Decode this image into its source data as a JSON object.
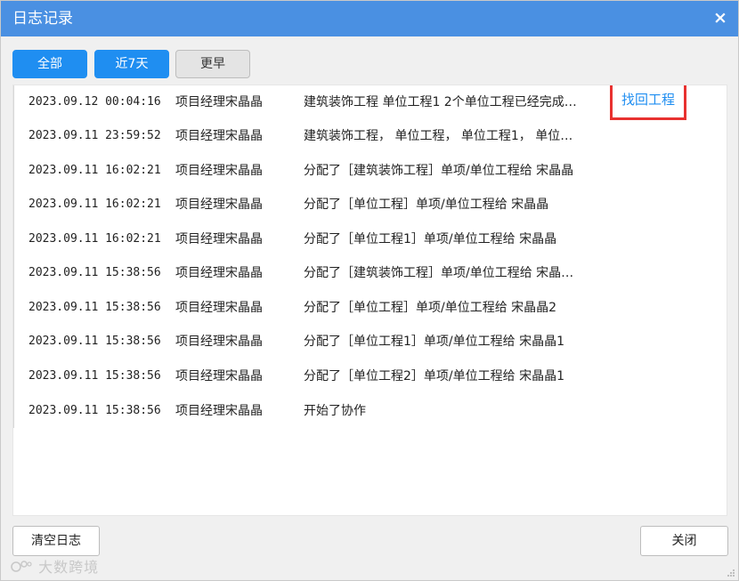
{
  "window": {
    "title": "日志记录",
    "close_glyph": "×"
  },
  "tabs": [
    {
      "label": "全部",
      "active": true
    },
    {
      "label": "近7天",
      "active": true
    },
    {
      "label": "更早",
      "active": false
    }
  ],
  "logs": [
    {
      "time": "2023.09.12 00:04:16",
      "user": "项目经理宋晶晶",
      "action": "建筑装饰工程 单位工程1 2个单位工程已经完成…",
      "link": "找回工程"
    },
    {
      "time": "2023.09.11 23:59:52",
      "user": "项目经理宋晶晶",
      "action": "建筑装饰工程， 单位工程， 单位工程1， 单位…"
    },
    {
      "time": "2023.09.11 16:02:21",
      "user": "项目经理宋晶晶",
      "action": "分配了［建筑装饰工程］单项/单位工程给 宋晶晶"
    },
    {
      "time": "2023.09.11 16:02:21",
      "user": "项目经理宋晶晶",
      "action": "分配了［单位工程］单项/单位工程给 宋晶晶"
    },
    {
      "time": "2023.09.11 16:02:21",
      "user": "项目经理宋晶晶",
      "action": "分配了［单位工程1］单项/单位工程给 宋晶晶"
    },
    {
      "time": "2023.09.11 15:38:56",
      "user": "项目经理宋晶晶",
      "action": "分配了［建筑装饰工程］单项/单位工程给 宋晶…"
    },
    {
      "time": "2023.09.11 15:38:56",
      "user": "项目经理宋晶晶",
      "action": "分配了［单位工程］单项/单位工程给 宋晶晶2"
    },
    {
      "time": "2023.09.11 15:38:56",
      "user": "项目经理宋晶晶",
      "action": "分配了［单位工程1］单项/单位工程给 宋晶晶1"
    },
    {
      "time": "2023.09.11 15:38:56",
      "user": "项目经理宋晶晶",
      "action": "分配了［单位工程2］单项/单位工程给 宋晶晶1"
    },
    {
      "time": "2023.09.11 15:38:56",
      "user": "项目经理宋晶晶",
      "action": "开始了协作"
    }
  ],
  "footer": {
    "clear_label": "清空日志",
    "close_label": "关闭"
  },
  "watermark": {
    "text": "大数跨境"
  },
  "colors": {
    "titlebar": "#4a90e2",
    "accent": "#1f8ef1",
    "highlight_border": "#e8312f"
  }
}
